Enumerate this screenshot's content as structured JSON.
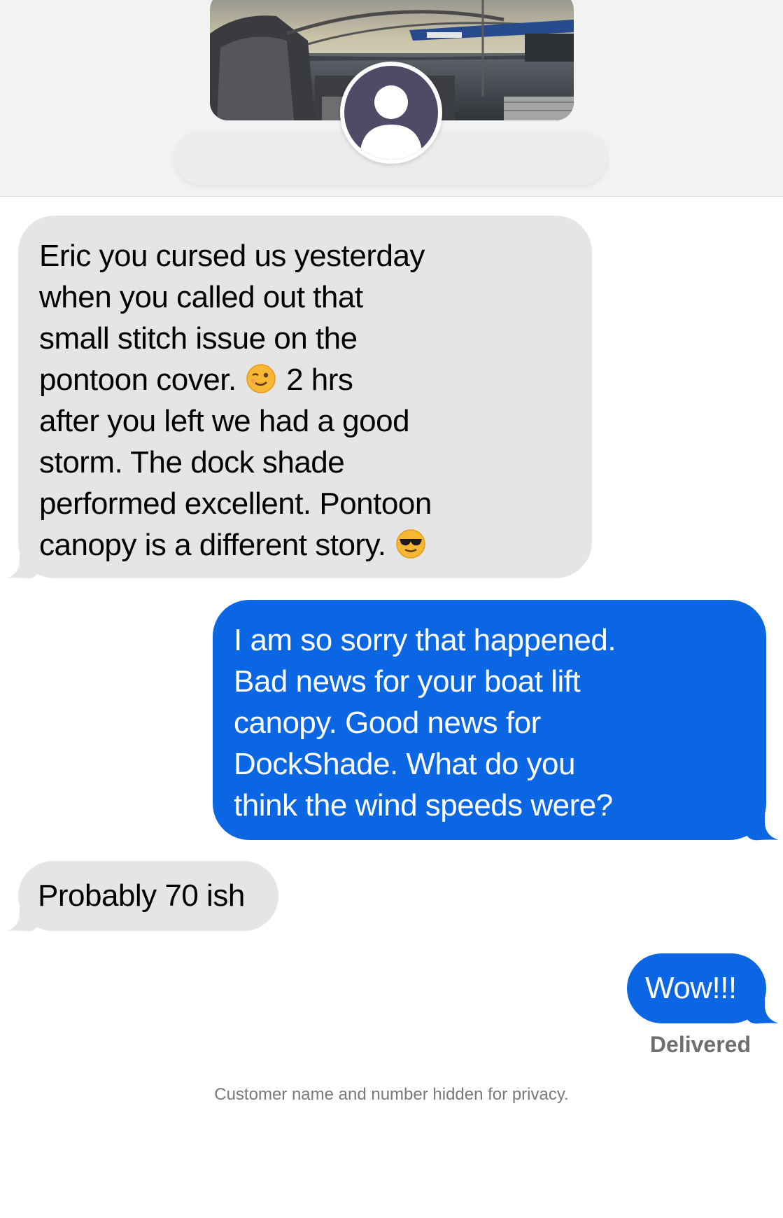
{
  "messages": [
    {
      "direction": "incoming",
      "line1": "Eric you cursed us yesterday\nwhen you called out that\nsmall stitch issue on the\npontoon cover. ",
      "emoji1": "wink-emoji",
      "line2": " 2 hrs\nafter you left we had a good\nstorm. The dock shade\nperformed excellent. Pontoon\ncanopy is a different story. ",
      "emoji2": "sunglasses-emoji"
    },
    {
      "direction": "outgoing",
      "text": "I am so sorry that happened.\nBad news for your boat lift\ncanopy. Good news for\nDockShade. What do you\nthink the wind speeds were?"
    },
    {
      "direction": "incoming",
      "text": "Probably 70 ish"
    },
    {
      "direction": "outgoing",
      "text": "Wow!!!"
    }
  ],
  "status": "Delivered",
  "footer": "Customer name and number hidden for privacy.",
  "colors": {
    "outgoing": "#0b66e4",
    "incoming": "#e5e5e5",
    "header_bg": "#f2f2f2"
  },
  "icons": {
    "avatar": "person-silhouette-icon",
    "photo": "pontoon-boat-photo"
  }
}
